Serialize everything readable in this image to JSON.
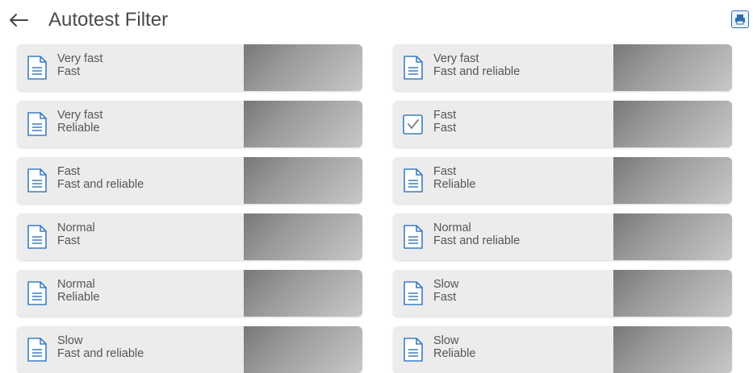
{
  "header": {
    "back_icon": "arrow-left-icon",
    "title": "Autotest Filter",
    "print_icon": "printer-icon"
  },
  "tiles": [
    {
      "line1": "Very fast",
      "line2": "Fast",
      "icon": "document-icon"
    },
    {
      "line1": "Very fast",
      "line2": "Fast and reliable",
      "icon": "document-icon"
    },
    {
      "line1": "Very fast",
      "line2": "Reliable",
      "icon": "document-icon"
    },
    {
      "line1": "Fast",
      "line2": "Fast",
      "icon": "checkmark-icon"
    },
    {
      "line1": "Fast",
      "line2": "Fast and reliable",
      "icon": "document-icon"
    },
    {
      "line1": "Fast",
      "line2": "Reliable",
      "icon": "document-icon"
    },
    {
      "line1": "Normal",
      "line2": "Fast",
      "icon": "document-icon"
    },
    {
      "line1": "Normal",
      "line2": "Fast and reliable",
      "icon": "document-icon"
    },
    {
      "line1": "Normal",
      "line2": "Reliable",
      "icon": "document-icon"
    },
    {
      "line1": "Slow",
      "line2": "Fast",
      "icon": "document-icon"
    },
    {
      "line1": "Slow",
      "line2": "Fast and reliable",
      "icon": "document-icon"
    },
    {
      "line1": "Slow",
      "line2": "Reliable",
      "icon": "document-icon"
    }
  ],
  "colors": {
    "accent": "#2c6db3",
    "tile_bg": "#ececec",
    "text": "#555555"
  }
}
